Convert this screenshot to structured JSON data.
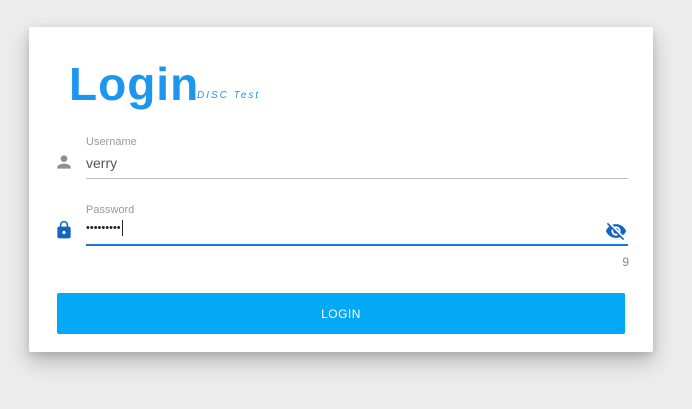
{
  "header": {
    "title": "Login",
    "subtitle": "DISC Test"
  },
  "username": {
    "label": "Username",
    "value": "verry",
    "icon": "person-icon"
  },
  "password": {
    "label": "Password",
    "masked_value": "•••••••••",
    "icon": "lock-icon",
    "toggle_icon": "eye-off-icon",
    "char_count": "9"
  },
  "actions": {
    "login_label": "LOGIN"
  },
  "colors": {
    "accent": "#1e96ef",
    "button": "#03a9f4",
    "active_line": "#1976d2",
    "icon_gray": "#8f8f8f",
    "icon_blue": "#1565c0"
  }
}
